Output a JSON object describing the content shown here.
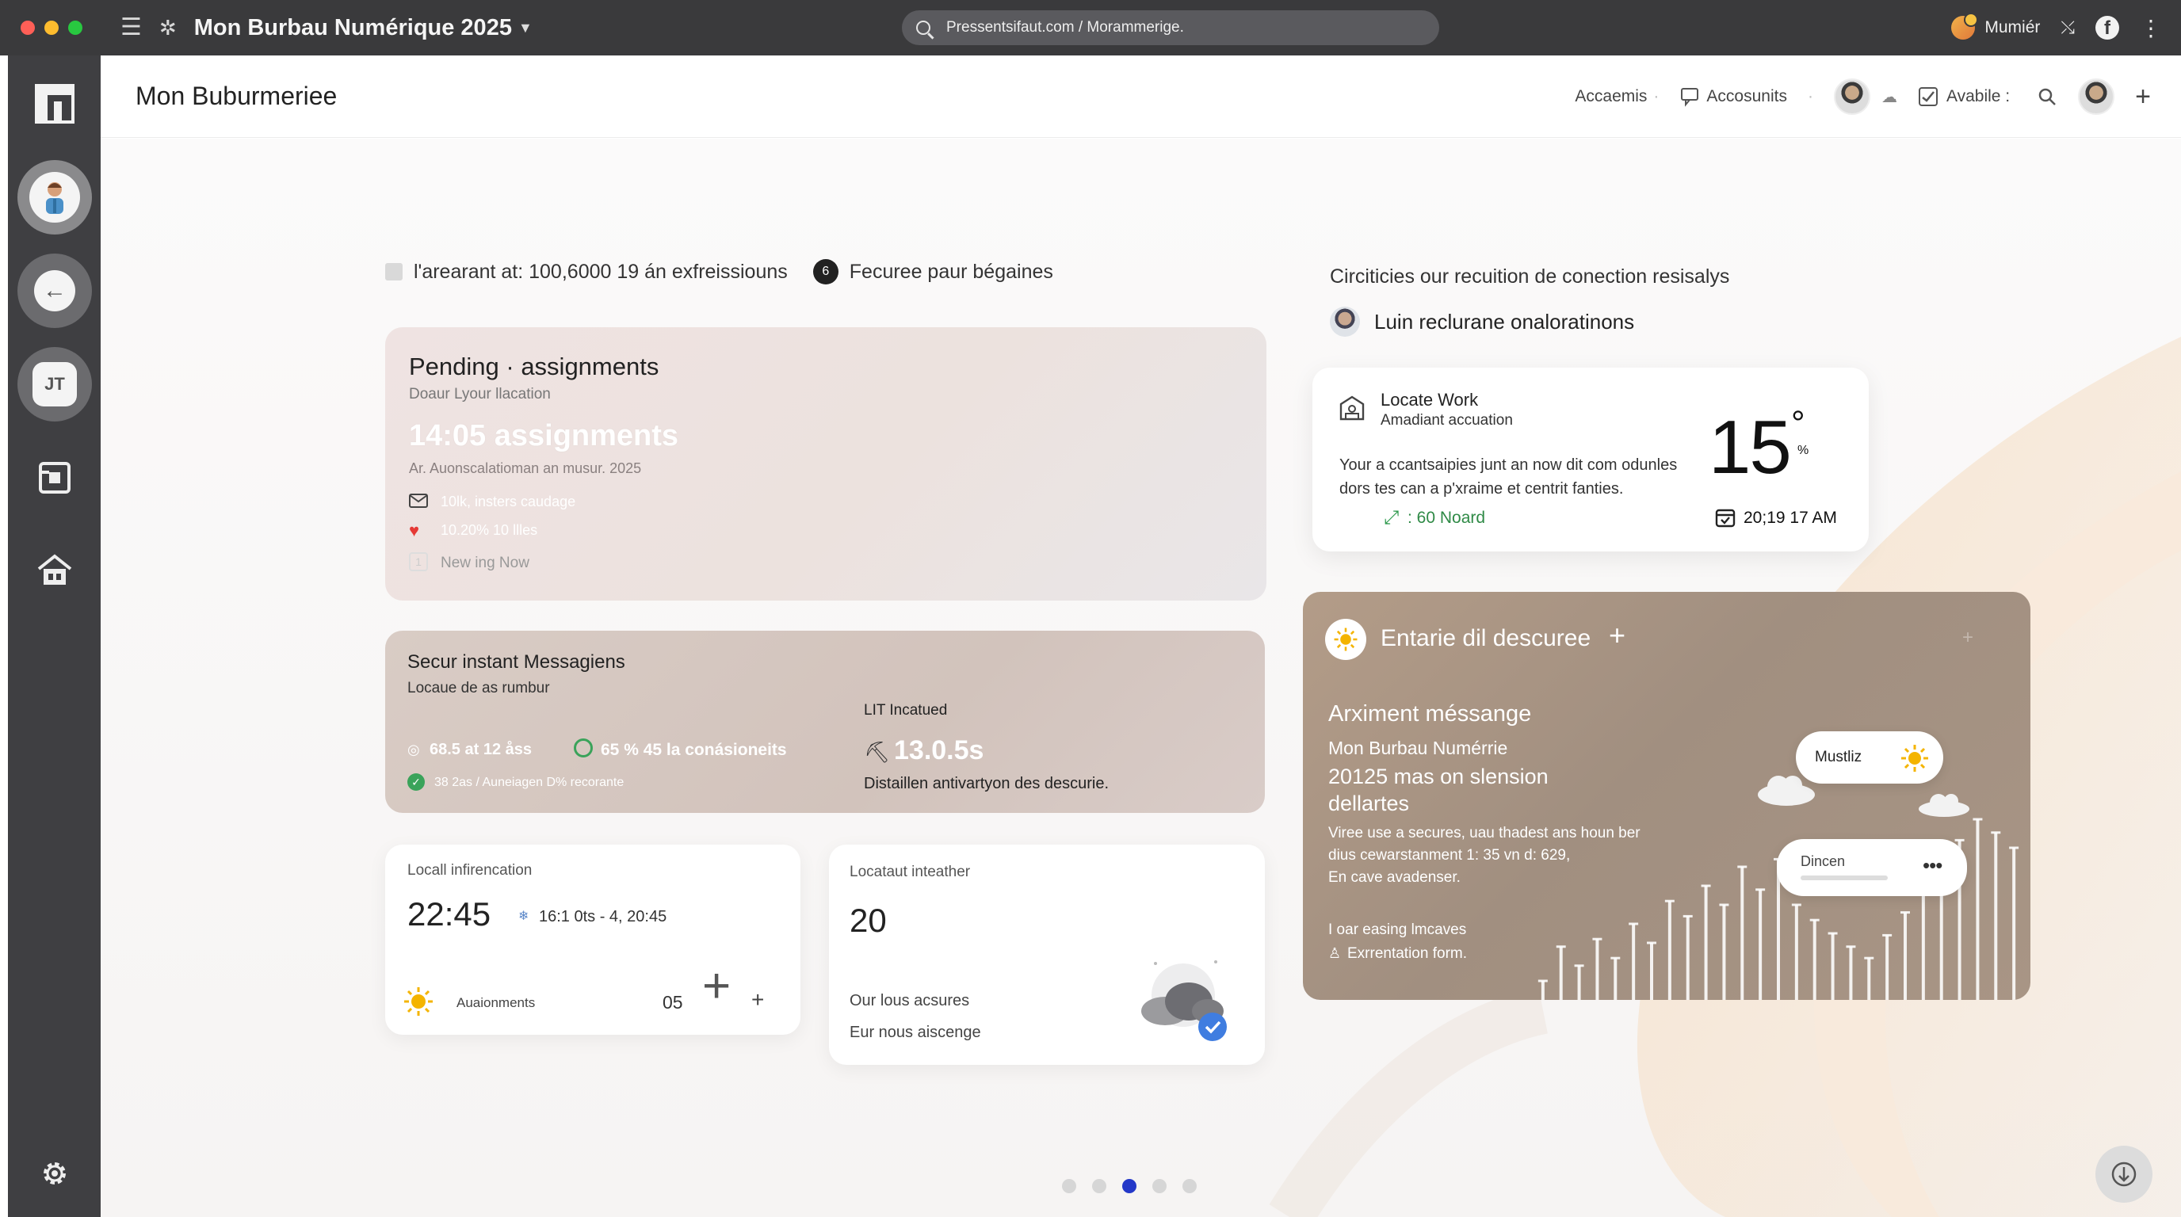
{
  "titlebar": {
    "title": "Mon Burbau Numérique 2025",
    "url": "Pressentsifaut.com / Morammerige.",
    "user_name": "Mumiér"
  },
  "app": {
    "title": "Mon Buburmeriee",
    "header": {
      "accaemis": "Accaemis",
      "accounts": "Accosunits",
      "available": "Avabile :"
    }
  },
  "topline": {
    "text1": "l'arearant at: 100,6000  19 án exfreissiouns",
    "text2": "Fecuree paur bégaines"
  },
  "pending": {
    "title": "Pending · assignments",
    "subtitle": "Doaur Lyour llacation",
    "big": "14:05 assignments",
    "line": "Ar.  Auonscalatioman an  musur. 2025",
    "item1": "10lk, insters caudage",
    "item2": "10.20% 10 llles",
    "item3": "New ing  Now"
  },
  "secure": {
    "title": "Secur instant Messagiens",
    "subtitle": "Locaue de as rumbur",
    "stat1": "68.5 at 12 åss",
    "stat2": "65 % 45 la conásioneits",
    "stat3": "38 2as / Auneiagen D% recorante",
    "col_label": "LIT  Incatued",
    "col_big": "13.0.5s",
    "col_desc": "Distaillen antivartyon des descurie."
  },
  "info": {
    "label": "Locall infirencation",
    "time": "22:45",
    "time_range": "16:1 0ts  -  4, 20:45",
    "footer_label": "Auaionments",
    "count": "05"
  },
  "weather2": {
    "label": "Locataut inteather",
    "value": "20",
    "line1": "Our lous acsures",
    "line2": "Eur nous aiscenge"
  },
  "right": {
    "line1": "Circiticies our recuition de conection resisalys",
    "line2": "Luin reclurane onaloratinons"
  },
  "locate": {
    "title": "Locate Work",
    "subtitle": "Amadiant accuation",
    "temp": "15",
    "temp_unit": "°",
    "temp_sub": "%",
    "desc1": "Your a ccantsaipies junt an now dit com odunles",
    "desc2": "dors tes can a p'xraime et centrit fanties.",
    "stat": ": 60 Noard",
    "time": "20;19 17 AM"
  },
  "brown": {
    "title": "Entarie dil descuree",
    "heading": "Arximent méssange",
    "h2a": "Mon Burbau Numérrie",
    "h2b": "20125 mas on slension",
    "h2c": "dellartes",
    "p1": "Viree use a secures, uau thadest ans houn ber",
    "p2": "dius cewarstanment 1: 35 vn d: 629,",
    "p3": "En cave avadenser.",
    "f1": "I oar easing lmcaves",
    "f2": "Exrrentation form.",
    "bubble1": "Mustliz",
    "bubble2": "Dincen",
    "bar_levels": [
      0.1,
      0.28,
      0.18,
      0.32,
      0.22,
      0.4,
      0.3,
      0.52,
      0.44,
      0.6,
      0.5,
      0.7,
      0.58,
      0.74,
      0.5,
      0.42,
      0.35,
      0.28,
      0.22,
      0.34,
      0.46,
      0.6,
      0.72,
      0.84,
      0.95,
      0.88,
      0.8
    ]
  },
  "pager": {
    "count": 5,
    "active": 2
  },
  "colors": {
    "accent": "#2438c8",
    "dock": "#3f3f42",
    "titlebar": "#3a3a3c"
  }
}
